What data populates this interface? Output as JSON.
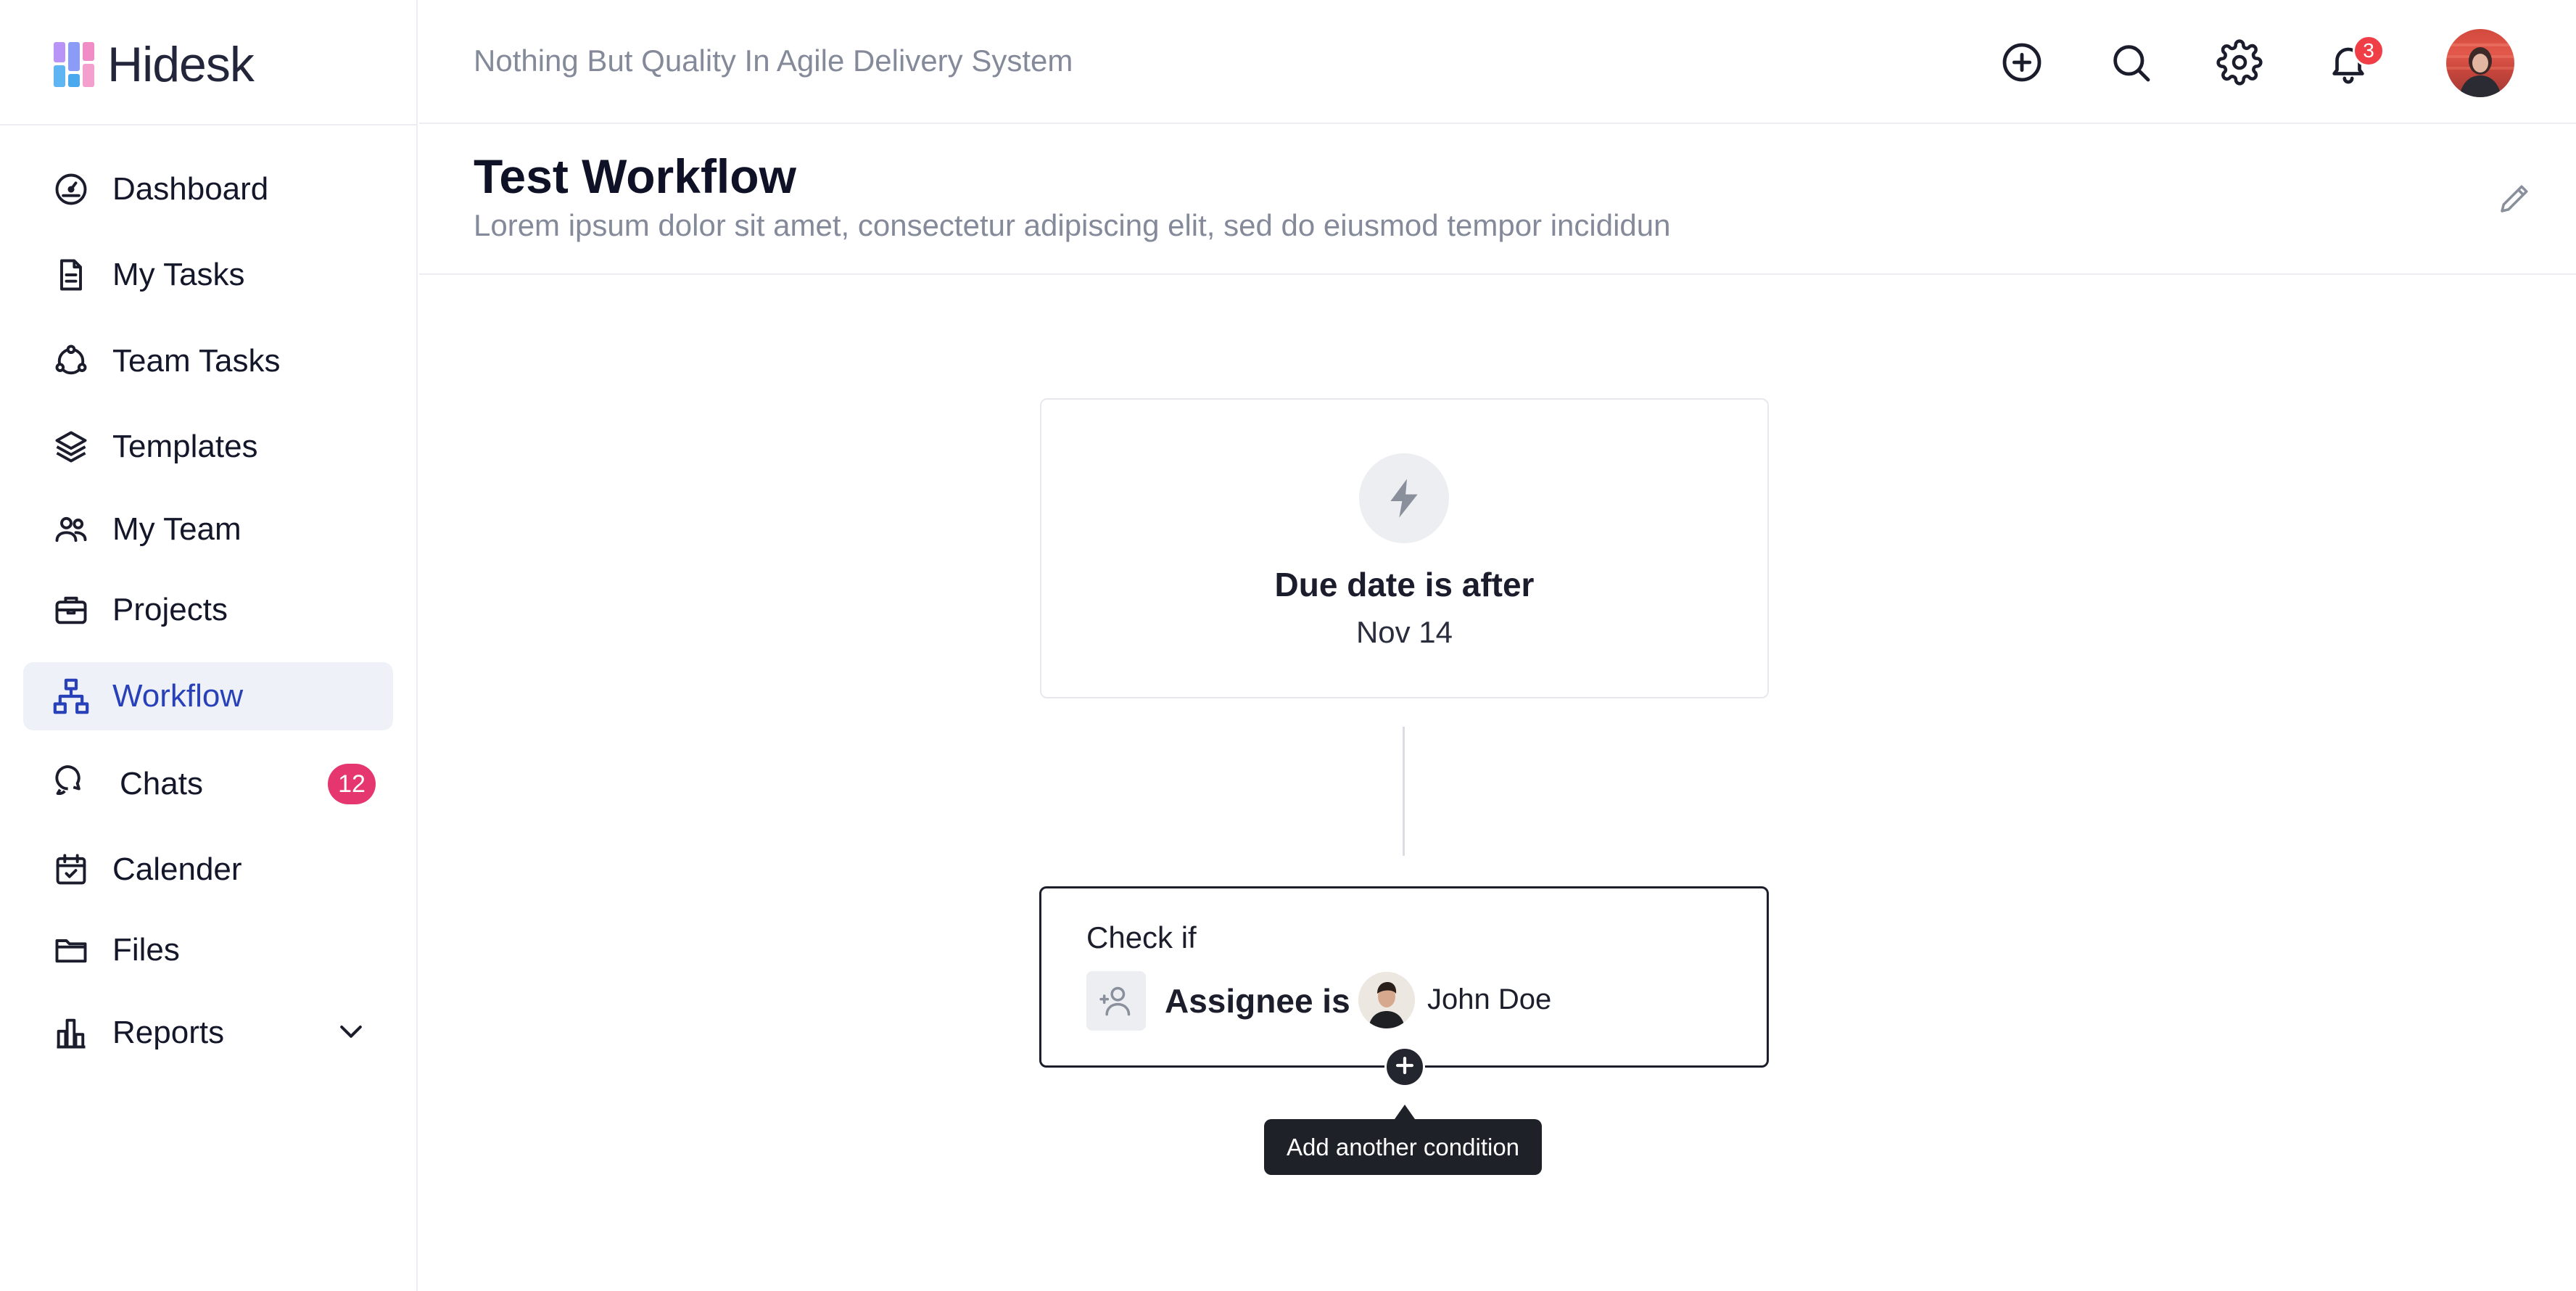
{
  "brand": {
    "name": "Hidesk",
    "logo_colors": [
      "#a78bfa",
      "#60a5fa",
      "#f472b6",
      "#38bdf8"
    ]
  },
  "header": {
    "tagline": "Nothing But Quality In Agile Delivery System",
    "icons": [
      "plus-circle-icon",
      "search-icon",
      "gear-icon",
      "bell-icon"
    ],
    "notification_count": "3"
  },
  "sidebar": {
    "items": [
      {
        "label": "Dashboard",
        "icon": "dashboard-gauge-icon"
      },
      {
        "label": "My Tasks",
        "icon": "document-icon"
      },
      {
        "label": "Team Tasks",
        "icon": "team-cycle-icon"
      },
      {
        "label": "Templates",
        "icon": "layers-icon"
      },
      {
        "label": "My Team",
        "icon": "users-icon"
      },
      {
        "label": "Projects",
        "icon": "briefcase-icon"
      },
      {
        "label": "Workflow",
        "icon": "hierarchy-icon",
        "active": true
      },
      {
        "label": "Chats",
        "icon": "chat-bubbles-icon",
        "badge": "12"
      },
      {
        "label": "Calender",
        "icon": "calendar-check-icon"
      },
      {
        "label": "Files",
        "icon": "folder-icon"
      },
      {
        "label": "Reports",
        "icon": "bar-chart-icon",
        "expandable": true
      }
    ],
    "active_color": "#2941b8",
    "badge_color": "#e5366f"
  },
  "page": {
    "title": "Test Workflow",
    "description": "Lorem ipsum dolor sit amet, consectetur adipiscing elit, sed do eiusmod tempor incididun"
  },
  "workflow": {
    "trigger": {
      "icon": "bolt-icon",
      "title": "Due date is after",
      "value": "Nov 14"
    },
    "condition": {
      "label": "Check if",
      "field": "Assignee is",
      "value": "John Doe"
    },
    "add_condition_tooltip": "Add another condition"
  }
}
